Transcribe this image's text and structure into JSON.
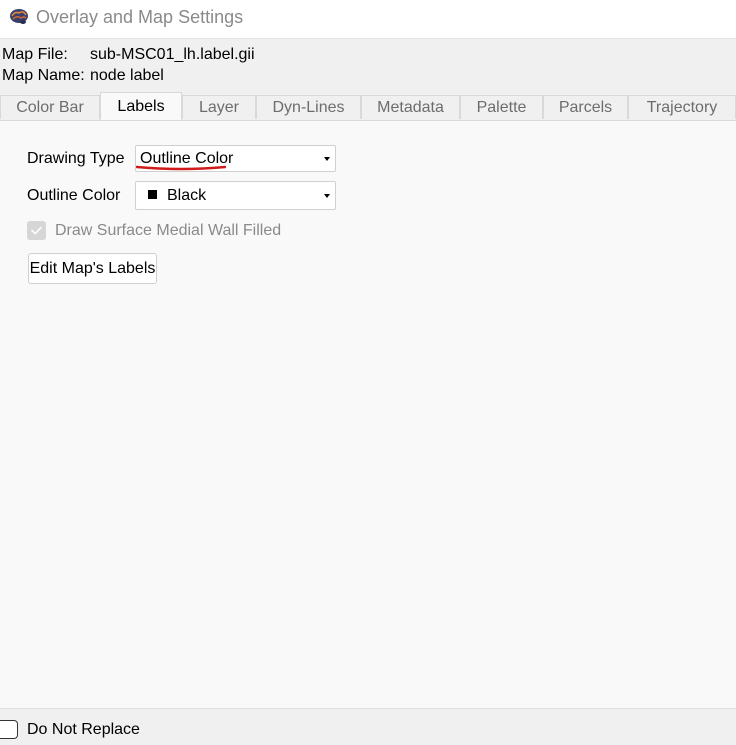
{
  "window": {
    "title": "Overlay and Map Settings",
    "icon": "brain-icon"
  },
  "map_info": {
    "file_label": "Map File:",
    "file_value": "sub-MSC01_lh.label.gii",
    "name_label": "Map Name:",
    "name_value": "node label"
  },
  "tabs": [
    {
      "label": "Color Bar",
      "active": false
    },
    {
      "label": "Labels",
      "active": true
    },
    {
      "label": "Layer",
      "active": false
    },
    {
      "label": "Dyn-Lines",
      "active": false
    },
    {
      "label": "Metadata",
      "active": false
    },
    {
      "label": "Palette",
      "active": false
    },
    {
      "label": "Parcels",
      "active": false
    },
    {
      "label": "Trajectory",
      "active": false
    }
  ],
  "labels_tab": {
    "drawing_type_label": "Drawing Type",
    "drawing_type_value": "Outline Color",
    "outline_color_label": "Outline Color",
    "outline_color_value": "Black",
    "outline_color_swatch": "#000000",
    "medial_wall_label": "Draw Surface Medial Wall Filled",
    "medial_wall_checked": true,
    "medial_wall_enabled": false,
    "edit_button_label": "Edit Map's Labels"
  },
  "bottom": {
    "do_not_replace_label": "Do Not Replace",
    "do_not_replace_checked": false
  },
  "colors": {
    "annotation_underline": "#d11a1a",
    "disabled_text": "#8a8a8a",
    "panel_bg": "#f9f9f9"
  }
}
